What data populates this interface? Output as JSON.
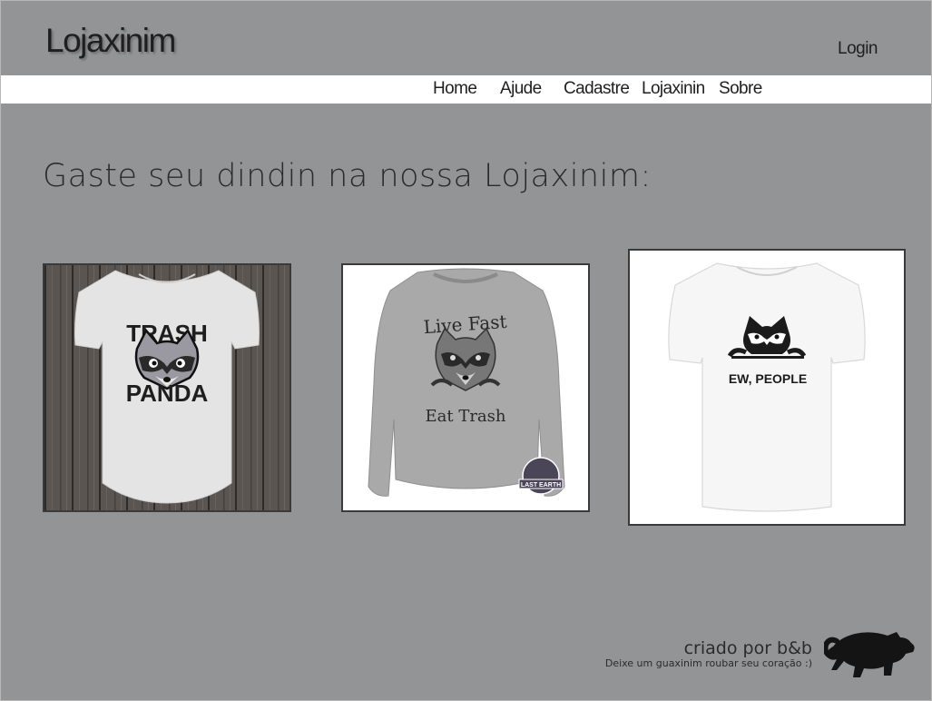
{
  "header": {
    "logo": "Lojaxinim",
    "login_label": "Login"
  },
  "nav": {
    "items": [
      {
        "label": "Home"
      },
      {
        "label": "Ajude"
      },
      {
        "label": "Cadastre"
      },
      {
        "label": "Lojaxinin"
      },
      {
        "label": "Sobre"
      }
    ]
  },
  "main": {
    "headline": "Gaste seu dindin na nossa Lojaxinim:",
    "products": [
      {
        "icon": "trash-panda-tshirt-image",
        "print_top": "TRASH",
        "print_bottom": "PANDA"
      },
      {
        "icon": "live-fast-sweatshirt-image",
        "print_top": "Live Fast",
        "print_bottom": "Eat Trash",
        "badge": "LAST EARTH"
      },
      {
        "icon": "ew-people-tshirt-image",
        "print": "EW, PEOPLE"
      }
    ]
  },
  "footer": {
    "title": "criado por b&b",
    "subtitle": "Deixe um guaxinim roubar seu coração :)",
    "icon": "raccoon-silhouette-icon"
  }
}
